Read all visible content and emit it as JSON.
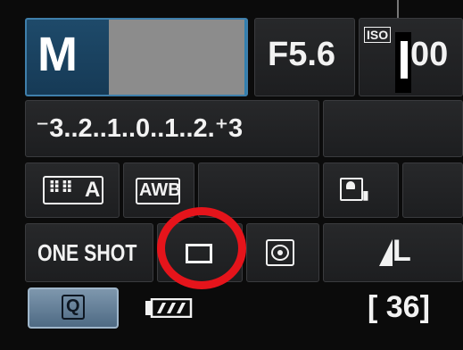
{
  "mode": {
    "label": "M"
  },
  "aperture": {
    "value": "F5.6"
  },
  "iso": {
    "label": "ISO",
    "value": "00"
  },
  "exposure": {
    "scale": "⁻3..2..1..0..1..2.⁺3"
  },
  "picture_style": {
    "symbol": "⠿⠿",
    "letter": "A"
  },
  "white_balance": {
    "label": "AWB"
  },
  "auto_lighting_optimizer": {
    "icon": "portrait-icon"
  },
  "af_mode": {
    "label": "ONE SHOT"
  },
  "drive_mode": {
    "icon": "single-shot-icon"
  },
  "metering": {
    "icon": "evaluative-metering-icon"
  },
  "image_quality": {
    "label": "L"
  },
  "quick_control": {
    "label": "Q"
  },
  "battery": {
    "icon": "battery-icon"
  },
  "shots_remaining": {
    "text": "[ 36]"
  },
  "colors": {
    "mode_highlight": "#1e4a6a",
    "quick_button": "#7e97ad",
    "annotation_circle": "#e5141b"
  }
}
